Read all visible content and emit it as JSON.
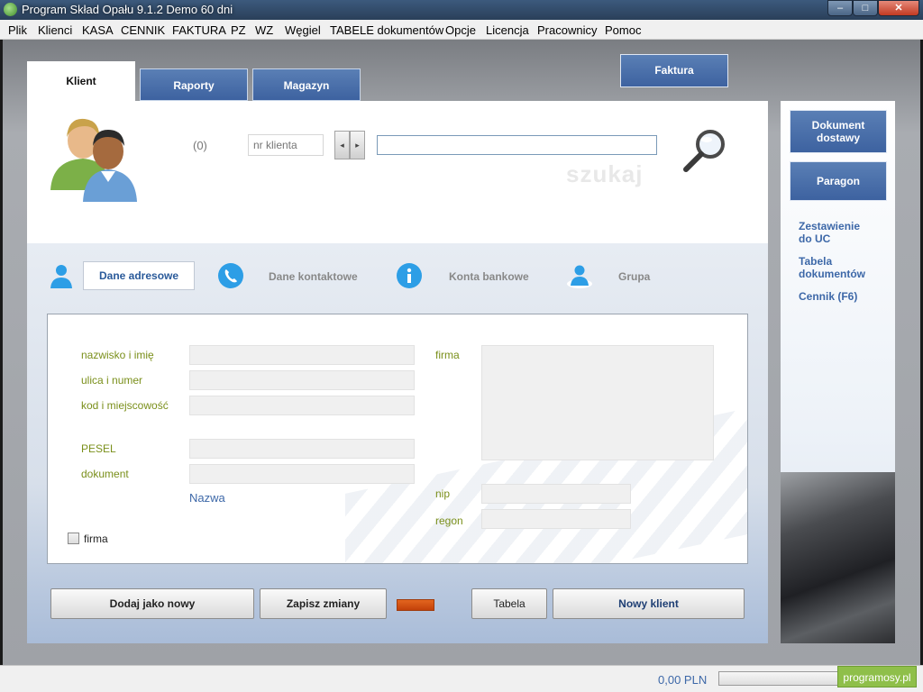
{
  "window": {
    "title": "Program Skład Opału 9.1.2   Demo 60 dni",
    "min": "–",
    "max": "□",
    "close": "✕"
  },
  "menu": [
    "Plik",
    "Klienci",
    "KASA",
    "CENNIK",
    "FAKTURA",
    "PZ",
    "WZ",
    "Węgiel",
    "TABELE dokumentów",
    "Opcje",
    "Licencja",
    "Pracownicy",
    "Pomoc"
  ],
  "tabs": {
    "klient": "Klient",
    "raporty": "Raporty",
    "magazyn": "Magazyn"
  },
  "faktura_button": "Faktura",
  "search": {
    "count": "(0)",
    "nr_placeholder": "nr klienta",
    "prev": "◂",
    "next": "▸",
    "query": "",
    "caption": "szukaj"
  },
  "subtabs": {
    "dane_adresowe": "Dane adresowe",
    "dane_kontaktowe": "Dane kontaktowe",
    "konta_bankowe": "Konta bankowe",
    "grupa": "Grupa"
  },
  "form": {
    "nazwisko_label": "nazwisko i imię",
    "ulica_label": "ulica i numer",
    "kod_label": "kod i miejscowość",
    "pesel_label": "PESEL",
    "dokument_label": "dokument",
    "nazwa_link": "Nazwa",
    "firma_label": "firma",
    "nip_label": "nip",
    "regon_label": "regon",
    "firma_checkbox_label": "firma",
    "firma_checked": false
  },
  "buttons": {
    "dodaj": "Dodaj jako nowy",
    "zapisz": "Zapisz zmiany",
    "tabela": "Tabela",
    "nowy_klient": "Nowy klient"
  },
  "sidebar": {
    "dokument_dostawy_line1": "Dokument",
    "dokument_dostawy_line2": "dostawy",
    "paragon": "Paragon",
    "zestawienie_line1": "Zestawienie",
    "zestawienie_line2": "do UC",
    "tabela_line1": "Tabela",
    "tabela_line2": "dokumentów",
    "cennik": "Cennik (F6)"
  },
  "status": {
    "amount": "0,00 PLN",
    "brand": "programosy.pl"
  },
  "colors": {
    "accent_blue": "#3d62a0",
    "label_green": "#7a8f1a",
    "link_blue": "#3d68a8",
    "indicator_orange": "#e3651f"
  }
}
